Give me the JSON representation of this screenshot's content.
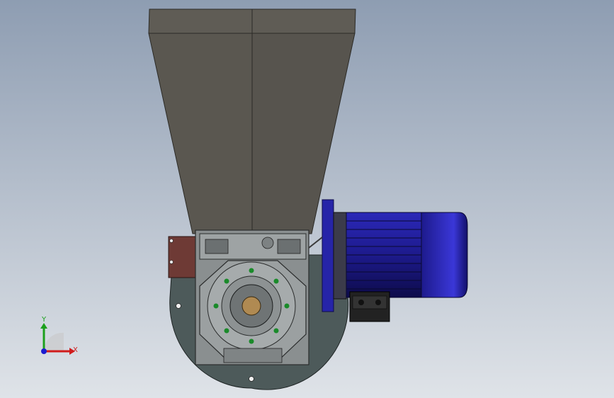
{
  "viewport": {
    "background_top": "#8e9db2",
    "background_bottom": "#dfe3e8"
  },
  "colors": {
    "hopper": "#5a5750",
    "hopper_edge": "#2b2a26",
    "flange": "#4d5a5a",
    "bracket": "#6e3a35",
    "gearbox": "#8a8f90",
    "gearbox_dark": "#4a4e4f",
    "motor": "#1d1a8c",
    "motor_dark": "#0d0b4a",
    "shaft": "#b08a52",
    "bolt": "#1a8a2a",
    "axis_x": "#d01c1c",
    "axis_y": "#1ca01c",
    "axis_z": "#1c1cd0"
  },
  "triad": {
    "x_label": "X",
    "y_label": "Y"
  },
  "icons": {
    "triad": "coordinate-triad-icon"
  }
}
